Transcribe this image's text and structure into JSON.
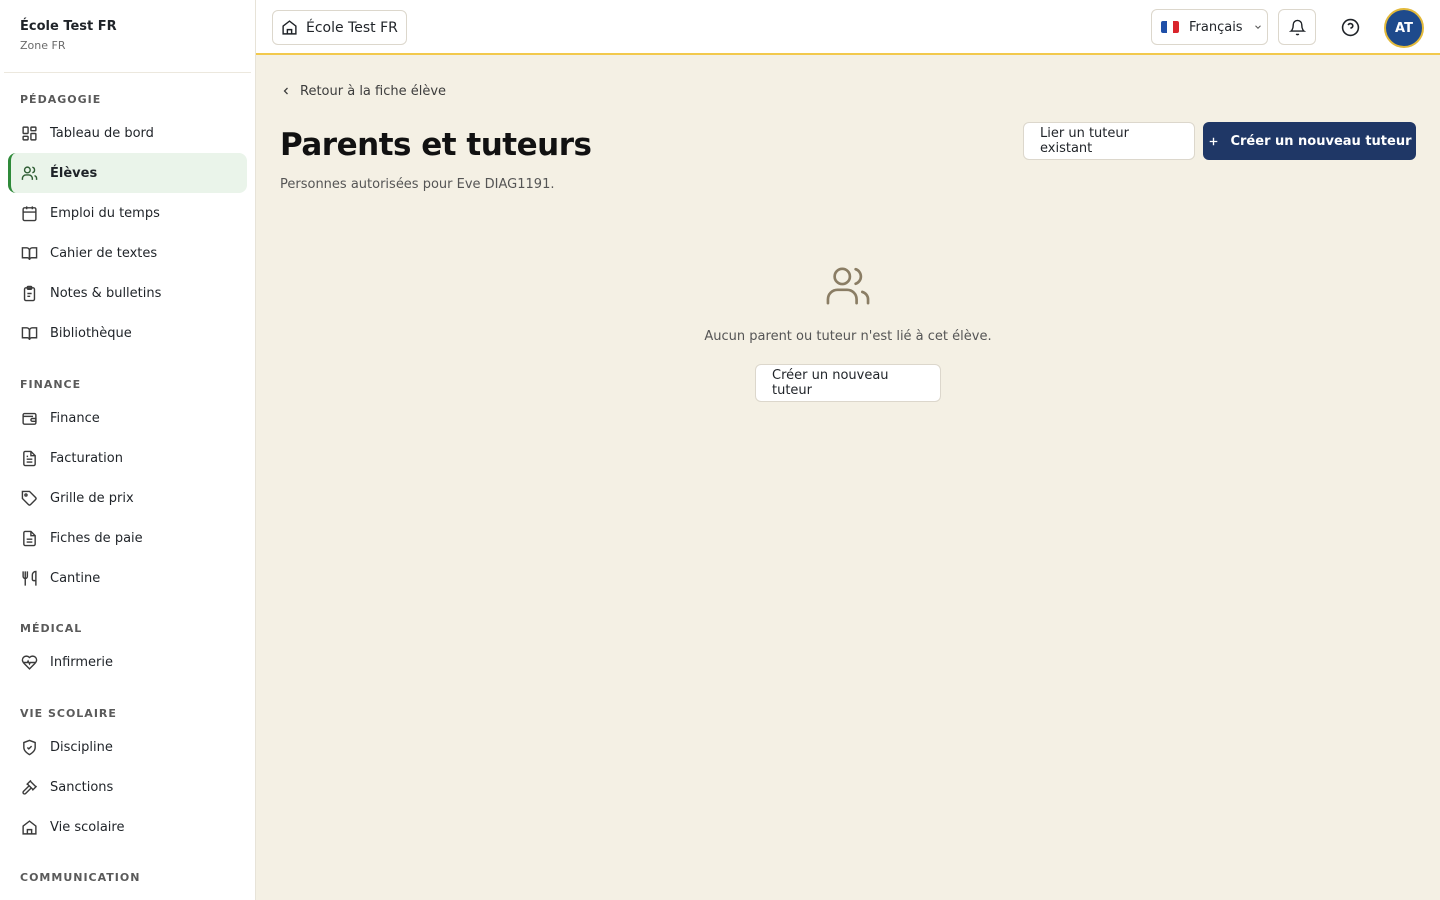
{
  "sidebar": {
    "school_name": "École Test FR",
    "school_zone": "Zone FR",
    "sections": [
      {
        "title": "PÉDAGOGIE",
        "items": [
          {
            "label": "Tableau de bord",
            "icon": "dashboard-icon"
          },
          {
            "label": "Élèves",
            "icon": "users-icon",
            "active": true
          },
          {
            "label": "Emploi du temps",
            "icon": "calendar-icon"
          },
          {
            "label": "Cahier de textes",
            "icon": "book-open-icon"
          },
          {
            "label": "Notes & bulletins",
            "icon": "clipboard-icon"
          },
          {
            "label": "Bibliothèque",
            "icon": "book-icon"
          }
        ]
      },
      {
        "title": "FINANCE",
        "items": [
          {
            "label": "Finance",
            "icon": "wallet-icon"
          },
          {
            "label": "Facturation",
            "icon": "file-text-icon"
          },
          {
            "label": "Grille de prix",
            "icon": "tag-icon"
          },
          {
            "label": "Fiches de paie",
            "icon": "receipt-icon"
          },
          {
            "label": "Cantine",
            "icon": "utensils-icon"
          }
        ]
      },
      {
        "title": "MÉDICAL",
        "items": [
          {
            "label": "Infirmerie",
            "icon": "heart-pulse-icon"
          }
        ]
      },
      {
        "title": "VIE SCOLAIRE",
        "items": [
          {
            "label": "Discipline",
            "icon": "shield-icon"
          },
          {
            "label": "Sanctions",
            "icon": "gavel-icon"
          },
          {
            "label": "Vie scolaire",
            "icon": "school-icon"
          }
        ]
      },
      {
        "title": "COMMUNICATION",
        "items": []
      }
    ]
  },
  "topbar": {
    "school_switch_label": "École Test FR",
    "language": "Français",
    "avatar_initials": "AT"
  },
  "main": {
    "back_label": "Retour à la fiche élève",
    "title": "Parents et tuteurs",
    "subtitle": "Personnes autorisées pour Eve DIAG1191.",
    "link_button": "Lier un tuteur existant",
    "create_button": "Créer un nouveau tuteur",
    "empty_text": "Aucun parent ou tuteur n'est lié à cet élève.",
    "empty_button": "Créer un nouveau tuteur"
  },
  "colors": {
    "accent_green": "#2f8a3a",
    "primary_navy": "#1f3766",
    "topbar_border": "#f2c94c",
    "page_background": "#f4f0e4"
  }
}
